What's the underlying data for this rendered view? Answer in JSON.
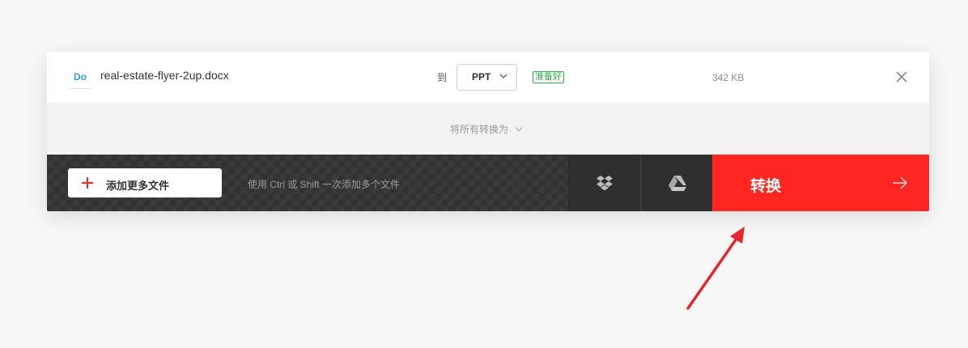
{
  "file": {
    "type_badge": "Do",
    "name": "real-estate-flyer-2up.docx",
    "to_label": "到",
    "target_format": "PPT",
    "status": "准备好",
    "size": "342 KB"
  },
  "convert_all": {
    "label": "将所有转换为"
  },
  "action_bar": {
    "add_files_label": "添加更多文件",
    "hint": "使用 Ctrl 或 Shift 一次添加多个文件",
    "convert_label": "转换"
  },
  "icons": {
    "remove": "close-icon",
    "dropbox": "dropbox-icon",
    "google_drive": "google-drive-icon",
    "add": "plus-icon",
    "convert": "arrow-right-icon"
  },
  "colors": {
    "accent": "#ff2621",
    "ready": "#30b04a",
    "doc_icon": "#2c9bd8",
    "annotation": "#e8262c"
  }
}
